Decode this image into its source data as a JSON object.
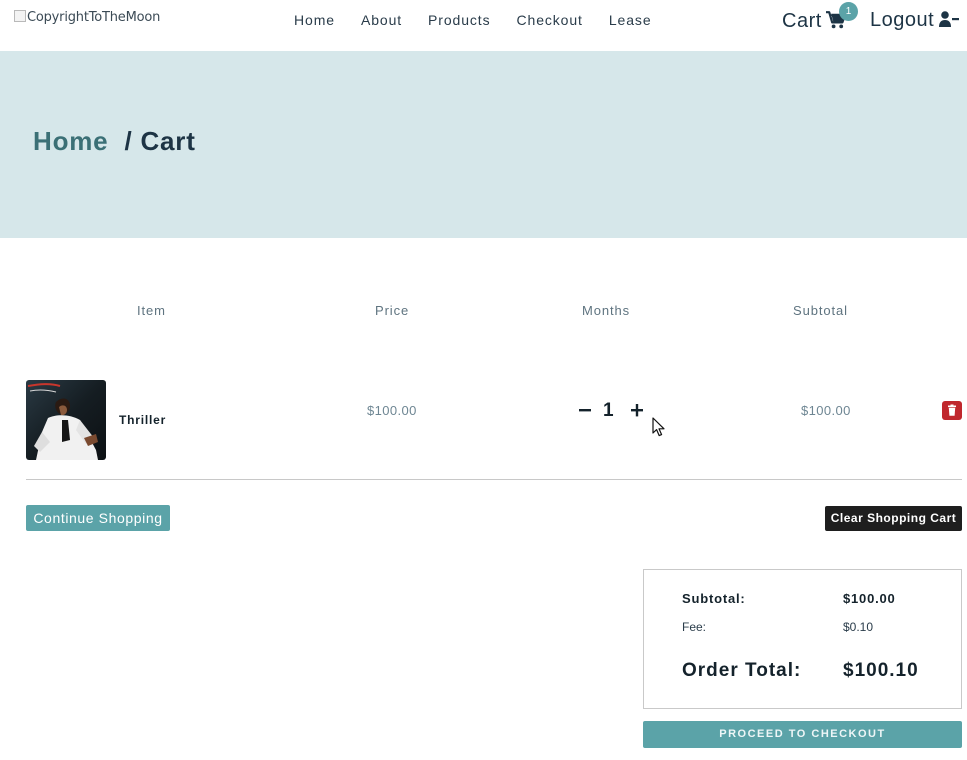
{
  "header": {
    "logo_alt": "CopyrightToTheMoon",
    "nav": [
      "Home",
      "About",
      "Products",
      "Checkout",
      "Lease"
    ],
    "cart_label": "Cart",
    "cart_count": "1",
    "logout_label": "Logout"
  },
  "breadcrumb": {
    "home": "Home",
    "separator": "/",
    "current": "Cart"
  },
  "table": {
    "headers": [
      "Item",
      "Price",
      "Months",
      "Subtotal"
    ],
    "rows": [
      {
        "name": "Thriller",
        "price": "$100.00",
        "quantity": "1",
        "subtotal": "$100.00"
      }
    ]
  },
  "actions": {
    "continue": "Continue Shopping",
    "clear": "Clear Shopping Cart"
  },
  "summary": {
    "subtotal_label": "Subtotal:",
    "subtotal_value": "$100.00",
    "fee_label": "Fee:",
    "fee_value": "$0.10",
    "total_label": "Order Total:",
    "total_value": "$100.10",
    "checkout": "PROCEED TO CHECKOUT"
  },
  "icons": {
    "cart": "shopping-cart-icon",
    "logout": "user-minus-icon",
    "delete": "trash-icon",
    "decrement": "minus-icon",
    "increment": "plus-icon"
  },
  "colors": {
    "accent": "#5ba3a8",
    "hero_bg": "#d6e7ea",
    "danger": "#c0272d",
    "dark": "#1e1e1e"
  }
}
